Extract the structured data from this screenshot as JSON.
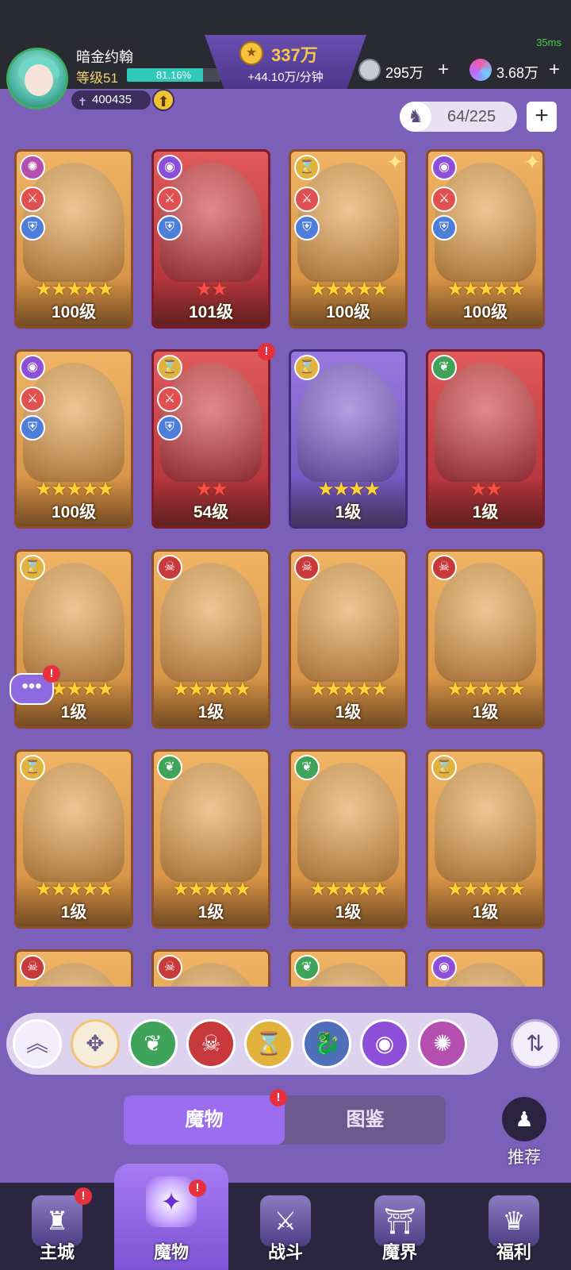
{
  "status": {
    "ping": "35ms"
  },
  "player": {
    "name": "暗金约翰",
    "level_label": "等级51",
    "xp_text": "81.16%",
    "xp_fraction": 0.8116,
    "power": "400435"
  },
  "currency": {
    "gold": "337万",
    "gold_rate": "+44.10万/分钟",
    "res1": "295万",
    "res2": "3.68万"
  },
  "roster": {
    "count": "64/225"
  },
  "cards": [
    {
      "level": "100级",
      "stars": "★★★★★",
      "star_color": "gold",
      "bg": "gold",
      "faction": "sun",
      "roles": true
    },
    {
      "level": "101级",
      "stars": "★★",
      "star_color": "red",
      "bg": "red",
      "faction": "eye",
      "roles": true
    },
    {
      "level": "100级",
      "stars": "★★★★★",
      "star_color": "gold",
      "bg": "gold",
      "faction": "hour",
      "roles": true,
      "sparkle": true
    },
    {
      "level": "100级",
      "stars": "★★★★★",
      "star_color": "gold",
      "bg": "gold",
      "faction": "eye",
      "roles": true,
      "sparkle": true
    },
    {
      "level": "100级",
      "stars": "★★★★★",
      "star_color": "gold",
      "bg": "gold",
      "faction": "eye",
      "roles": true
    },
    {
      "level": "54级",
      "stars": "★★",
      "star_color": "red",
      "bg": "red",
      "faction": "hour",
      "roles": true,
      "alert": true
    },
    {
      "level": "1级",
      "stars": "★★★★",
      "star_color": "gold",
      "bg": "purple",
      "faction": "hour",
      "roles": false
    },
    {
      "level": "1级",
      "stars": "★★",
      "star_color": "red",
      "bg": "red",
      "faction": "leaf",
      "roles": false
    },
    {
      "level": "1级",
      "stars": "★★★★★",
      "star_color": "gold",
      "bg": "gold",
      "faction": "hour",
      "roles": false
    },
    {
      "level": "1级",
      "stars": "★★★★★",
      "star_color": "gold",
      "bg": "gold",
      "faction": "skull",
      "roles": false
    },
    {
      "level": "1级",
      "stars": "★★★★★",
      "star_color": "gold",
      "bg": "gold",
      "faction": "skull",
      "roles": false
    },
    {
      "level": "1级",
      "stars": "★★★★★",
      "star_color": "gold",
      "bg": "gold",
      "faction": "skull",
      "roles": false
    },
    {
      "level": "1级",
      "stars": "★★★★★",
      "star_color": "gold",
      "bg": "gold",
      "faction": "hour",
      "roles": false
    },
    {
      "level": "1级",
      "stars": "★★★★★",
      "star_color": "gold",
      "bg": "gold",
      "faction": "leaf",
      "roles": false
    },
    {
      "level": "1级",
      "stars": "★★★★★",
      "star_color": "gold",
      "bg": "gold",
      "faction": "leaf",
      "roles": false
    },
    {
      "level": "1级",
      "stars": "★★★★★",
      "star_color": "gold",
      "bg": "gold",
      "faction": "hour",
      "roles": false
    },
    {
      "level": "",
      "stars": "",
      "star_color": "gold",
      "bg": "gold",
      "faction": "skull",
      "roles": false
    },
    {
      "level": "",
      "stars": "",
      "star_color": "gold",
      "bg": "gold",
      "faction": "skull",
      "roles": false
    },
    {
      "level": "",
      "stars": "",
      "star_color": "gold",
      "bg": "gold",
      "faction": "leaf",
      "roles": false
    },
    {
      "level": "",
      "stars": "",
      "star_color": "gold",
      "bg": "gold",
      "faction": "eye",
      "roles": false
    }
  ],
  "filters": [
    {
      "name": "collapse",
      "icon": "chevrons-up-icon",
      "glyph": "︽",
      "color": "#f3eefb"
    },
    {
      "name": "all",
      "icon": "all-factions-icon",
      "glyph": "✥",
      "color": "#f7ecd8"
    },
    {
      "name": "leaf",
      "icon": "leaf-faction-icon",
      "glyph": "❦",
      "color": "#3fa35a"
    },
    {
      "name": "skull",
      "icon": "demon-faction-icon",
      "glyph": "☠",
      "color": "#c8393c"
    },
    {
      "name": "hourglass",
      "icon": "hourglass-faction-icon",
      "glyph": "⌛",
      "color": "#e2b33c"
    },
    {
      "name": "dragon",
      "icon": "dragon-faction-icon",
      "glyph": "🐉",
      "color": "#4f6fb8"
    },
    {
      "name": "eye",
      "icon": "eye-faction-icon",
      "glyph": "◉",
      "color": "#8e4fd8"
    },
    {
      "name": "sun",
      "icon": "sun-faction-icon",
      "glyph": "✺",
      "color": "#b44fb0"
    }
  ],
  "tabs": {
    "monsters": "魔物",
    "codex": "图鉴"
  },
  "recommend": "推荐",
  "nav": [
    {
      "label": "主城",
      "icon": "castle-icon",
      "glyph": "♜",
      "alert": true
    },
    {
      "label": "魔物",
      "icon": "monster-flame-icon",
      "glyph": "✦",
      "alert": true,
      "active": true
    },
    {
      "label": "战斗",
      "icon": "battle-shield-icon",
      "glyph": "⚔",
      "alert": false
    },
    {
      "label": "魔界",
      "icon": "demon-realm-icon",
      "glyph": "⛩",
      "alert": false
    },
    {
      "label": "福利",
      "icon": "treasure-chest-icon",
      "glyph": "♛",
      "alert": false
    }
  ],
  "colors": {
    "accent": "#9b6ef0",
    "background": "#7b5fb8",
    "topbar": "#2a2a33",
    "gold": "#f5c84a"
  }
}
